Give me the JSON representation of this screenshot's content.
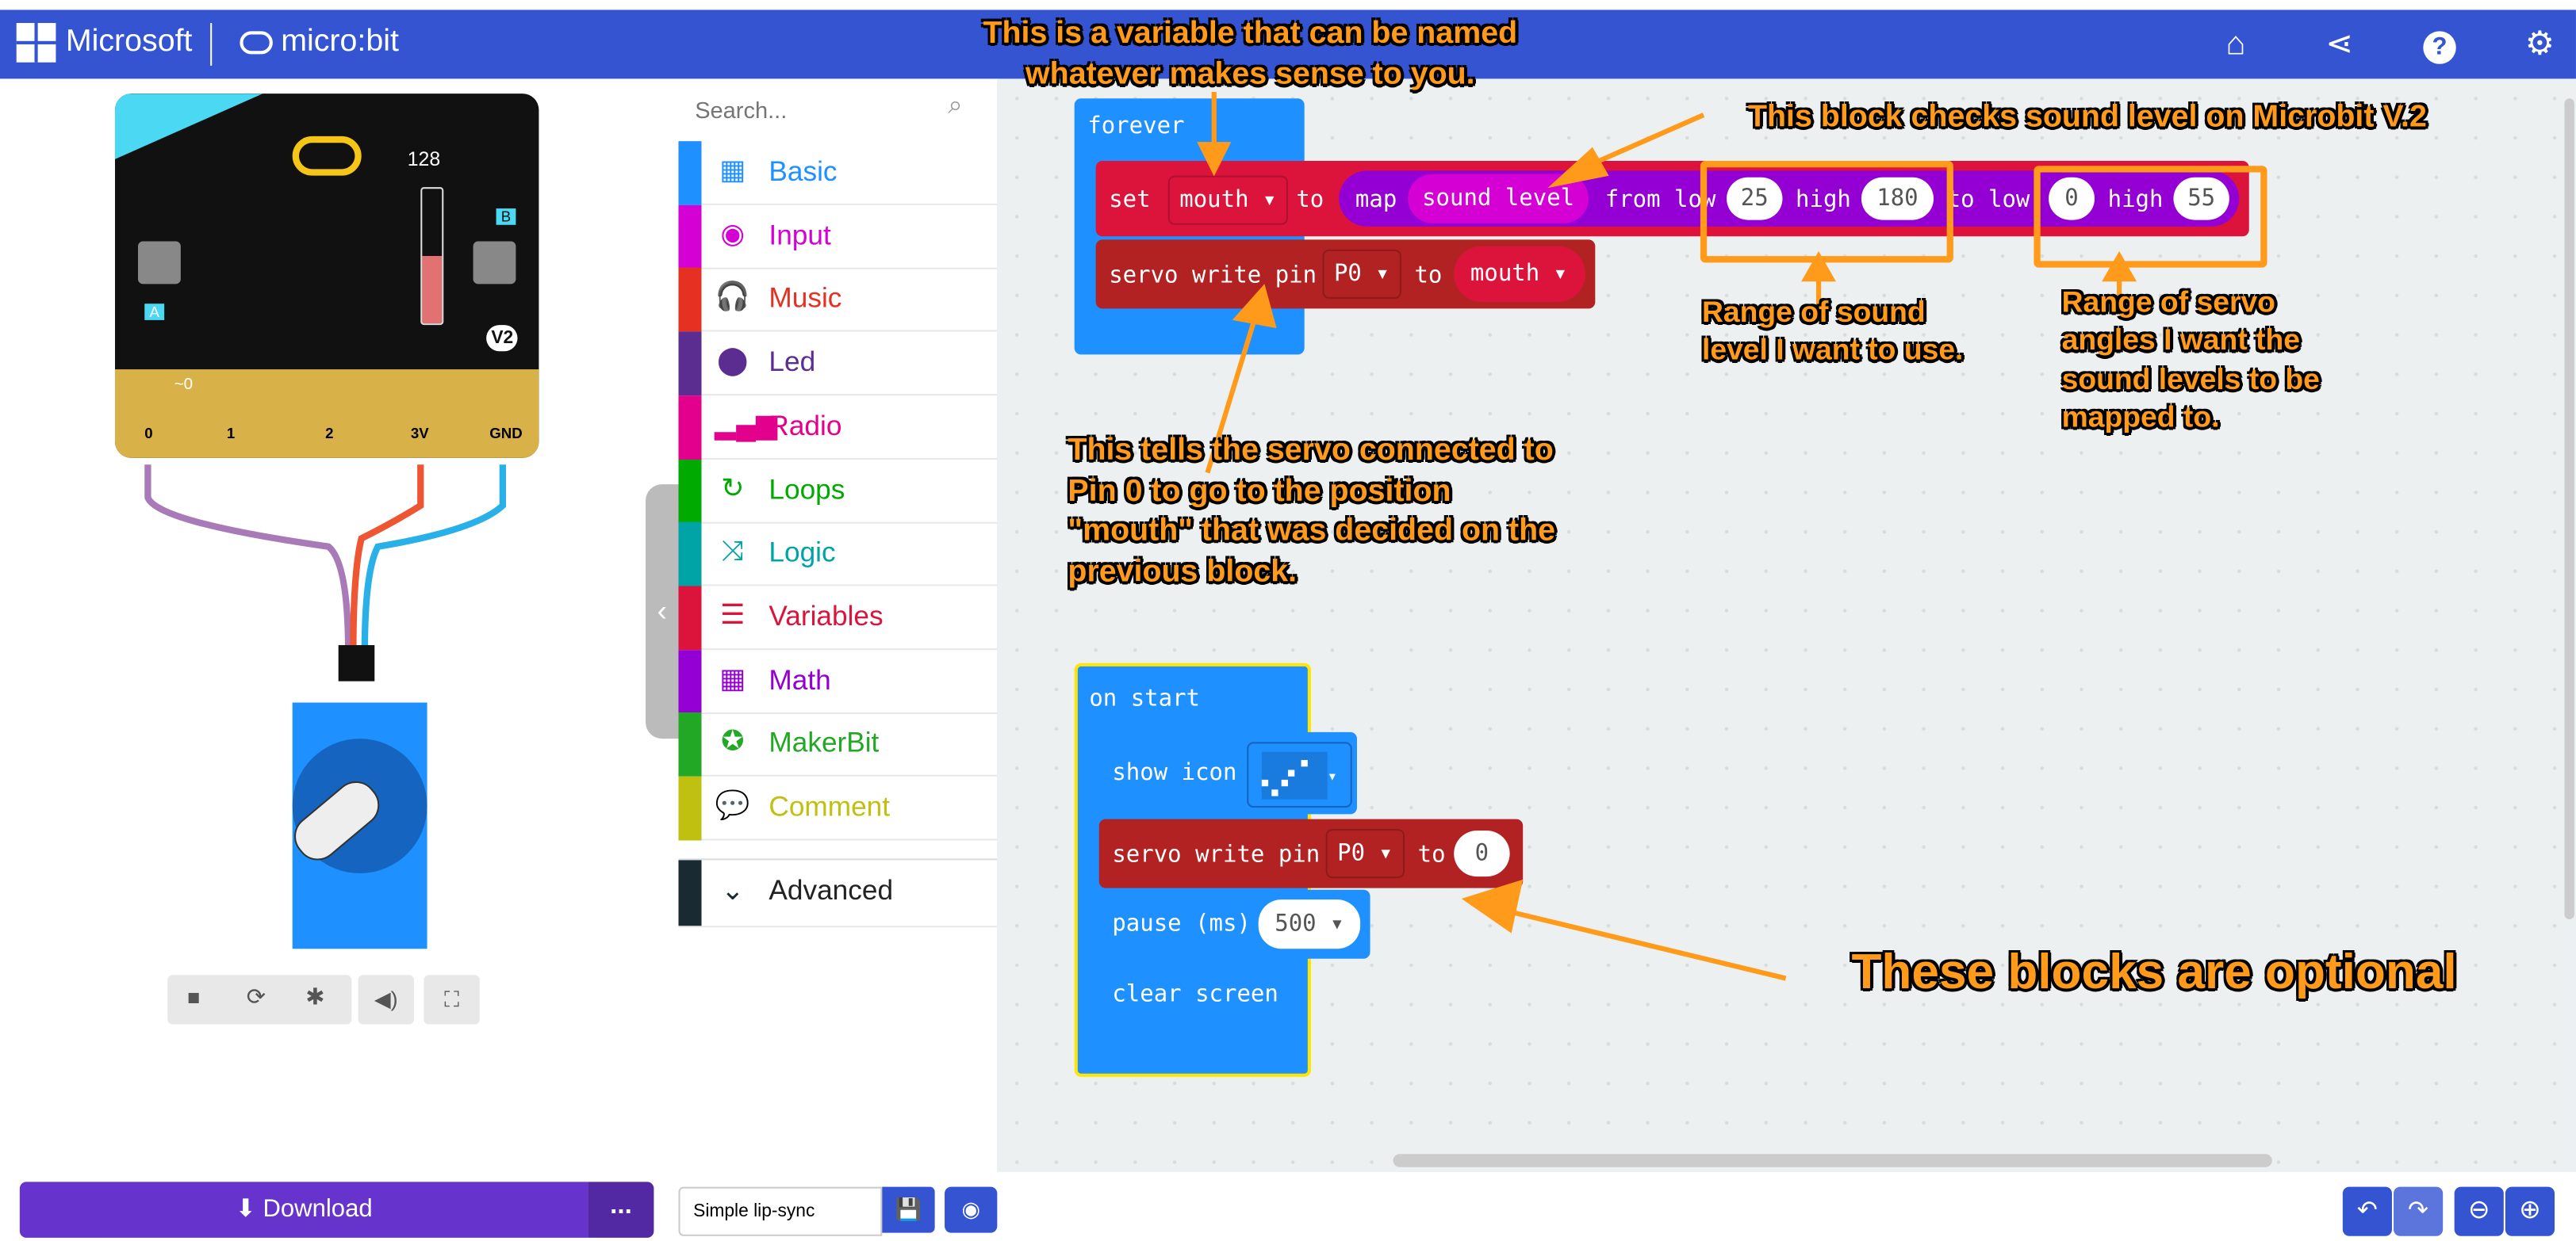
{
  "header": {
    "brand": "Microsoft",
    "product": "micro:bit",
    "icons": [
      "home-icon",
      "share-icon",
      "help-icon",
      "gear-icon"
    ]
  },
  "simulator": {
    "sound_level": "128",
    "badge": "V2",
    "pins": [
      "0",
      "1",
      "2",
      "3V",
      "GND"
    ],
    "button_a": "A",
    "button_b": "B",
    "pin_note": "~0",
    "controls": [
      "stop-icon",
      "restart-icon",
      "debug-icon",
      "mute-icon",
      "fullscreen-icon"
    ]
  },
  "toolbox": {
    "search_placeholder": "Search...",
    "categories": [
      {
        "label": "Basic",
        "color": "#1e90ff",
        "icon": "grid-icon"
      },
      {
        "label": "Input",
        "color": "#d400d4",
        "icon": "target-icon"
      },
      {
        "label": "Music",
        "color": "#e63022",
        "icon": "headphones-icon"
      },
      {
        "label": "Led",
        "color": "#5c2d91",
        "icon": "toggle-icon"
      },
      {
        "label": "Radio",
        "color": "#e3008c",
        "icon": "signal-icon"
      },
      {
        "label": "Loops",
        "color": "#00aa00",
        "icon": "refresh-icon"
      },
      {
        "label": "Logic",
        "color": "#00a4a6",
        "icon": "shuffle-icon"
      },
      {
        "label": "Variables",
        "color": "#dc143c",
        "icon": "list-icon"
      },
      {
        "label": "Math",
        "color": "#9400d3",
        "icon": "calculator-icon"
      },
      {
        "label": "MakerBit",
        "color": "#22a824",
        "icon": "star-icon"
      },
      {
        "label": "Comment",
        "color": "#c0c010",
        "icon": "comment-icon"
      }
    ],
    "advanced": "Advanced"
  },
  "blocks": {
    "forever": "forever",
    "set": "set",
    "var": "mouth",
    "to": "to",
    "map": "map",
    "sound_level": "sound level",
    "from_low": "from low",
    "high": "high",
    "to_low": "to low",
    "from_low_val": "25",
    "from_high_val": "180",
    "to_low_val": "0",
    "to_high_val": "55",
    "servo": "servo write pin",
    "pin": "P0",
    "servo_to": "to",
    "servo_var": "mouth",
    "on_start": "on start",
    "show_icon": "show icon",
    "servo2_val": "0",
    "pause": "pause (ms)",
    "pause_val": "500",
    "clear": "clear screen"
  },
  "annotations": {
    "variable": "This is a variable that can be named whatever makes sense to you.",
    "sound": "This block checks sound level on Microbit V.2",
    "range_sound": "Range of sound level I want to use.",
    "range_servo": "Range of servo angles I want the sound levels to be mapped to.",
    "servo": "This tells the servo connected to Pin 0 to go to the position \"mouth\" that was decided on the previous block.",
    "optional": "These blocks are optional"
  },
  "bottom": {
    "download": "Download",
    "more": "...",
    "project_name": "Simple lip-sync"
  },
  "colors": {
    "header": "#3454d1",
    "download": "#6633cc",
    "annotation": "#ff9a1a"
  }
}
